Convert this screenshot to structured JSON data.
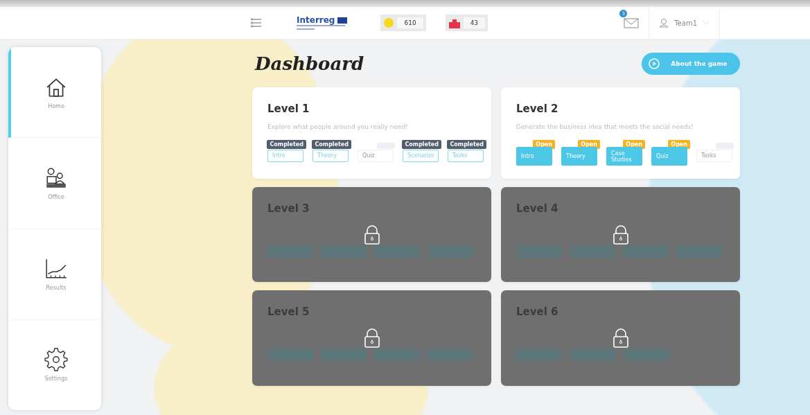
{
  "header": {
    "logo": "Interreg",
    "stats": [
      {
        "kind": "coins",
        "value": "610"
      },
      {
        "kind": "buildings",
        "value": "43"
      }
    ],
    "mail_badge": "3",
    "user": "Team1"
  },
  "sidebar": {
    "items": [
      {
        "kind": "home",
        "label": "Home",
        "selected": true
      },
      {
        "kind": "office",
        "label": "Office",
        "selected": false
      },
      {
        "kind": "results",
        "label": "Results",
        "selected": false
      },
      {
        "kind": "settings",
        "label": "Settings",
        "selected": false
      }
    ]
  },
  "title": "Dashboard",
  "about_button": "About the game",
  "levels": [
    {
      "title": "Level 1",
      "description": "Explore what people around you really need!",
      "locked": false,
      "modules": [
        {
          "label": "Intro",
          "kind": "completed",
          "badge": "Completed"
        },
        {
          "label": "Theory",
          "kind": "completed",
          "badge": "Completed"
        },
        {
          "label": "Quiz",
          "kind": "locked"
        },
        {
          "label": "Scenarios",
          "kind": "completed",
          "badge": "Completed"
        },
        {
          "label": "Tasks",
          "kind": "completed",
          "badge": "Completed"
        }
      ]
    },
    {
      "title": "Level 2",
      "description": "Generate the business idea that meets the social needs!",
      "locked": false,
      "modules": [
        {
          "label": "Intro",
          "kind": "open",
          "badge": "Open"
        },
        {
          "label": "Theory",
          "kind": "open",
          "badge": "Open"
        },
        {
          "label": "Case Studies",
          "kind": "open",
          "badge": "Open"
        },
        {
          "label": "Quiz",
          "kind": "open",
          "badge": "Open"
        },
        {
          "label": "Tasks",
          "kind": "locked"
        }
      ]
    },
    {
      "title": "Level 3",
      "locked": true,
      "modules": [
        {
          "kind": "locked"
        },
        {
          "kind": "locked"
        },
        {
          "kind": "locked"
        },
        {
          "kind": "locked"
        }
      ]
    },
    {
      "title": "Level 4",
      "locked": true,
      "modules": [
        {
          "kind": "locked"
        },
        {
          "kind": "locked"
        },
        {
          "kind": "locked"
        },
        {
          "kind": "locked"
        }
      ]
    },
    {
      "title": "Level 5",
      "locked": true,
      "modules": [
        {
          "kind": "locked"
        },
        {
          "kind": "locked"
        },
        {
          "kind": "locked"
        },
        {
          "kind": "locked"
        }
      ]
    },
    {
      "title": "Level 6",
      "locked": true,
      "modules": [
        {
          "kind": "locked"
        },
        {
          "kind": "locked"
        },
        {
          "kind": "locked"
        }
      ]
    }
  ]
}
